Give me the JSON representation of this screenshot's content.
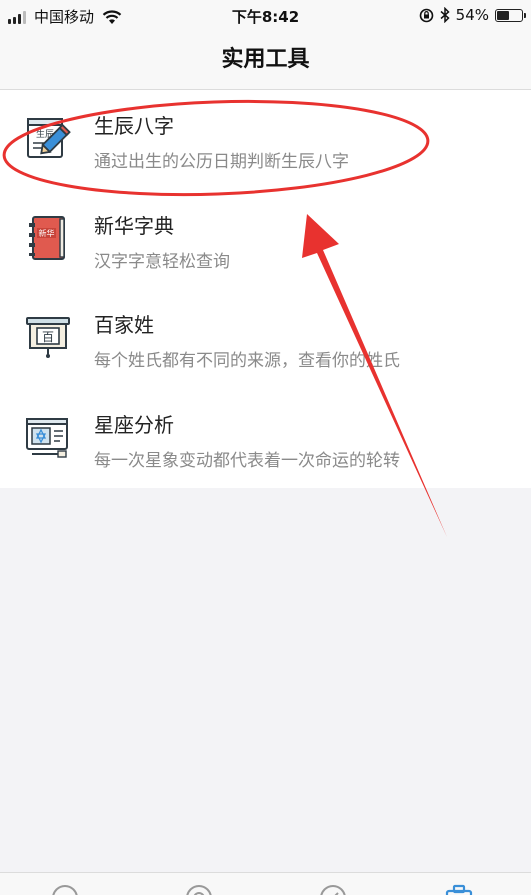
{
  "status_bar": {
    "carrier": "中国移动",
    "time": "下午8:42",
    "battery": "54%",
    "battery_level": 0.54
  },
  "nav": {
    "title": "实用工具"
  },
  "tools": [
    {
      "name": "生辰八字",
      "desc": "通过出生的公历日期判断生辰八字",
      "icon": "bazi-pencil-icon",
      "icon_text": "生辰"
    },
    {
      "name": "新华字典",
      "desc": "汉字字意轻松查询",
      "icon": "dictionary-book-icon",
      "icon_text": "新华"
    },
    {
      "name": "百家姓",
      "desc": "每个姓氏都有不同的来源，查看你的姓氏",
      "icon": "surname-board-icon",
      "icon_text": "百"
    },
    {
      "name": "星座分析",
      "desc": "每一次星象变动都代表着一次命运的轮转",
      "icon": "constellation-monitor-icon",
      "icon_text": ""
    }
  ],
  "annotation": {
    "color": "#e8322f"
  },
  "colors": {
    "accent": "#3a8fd8",
    "book_red": "#e05a4f",
    "icon_outline": "#2f3b44"
  }
}
